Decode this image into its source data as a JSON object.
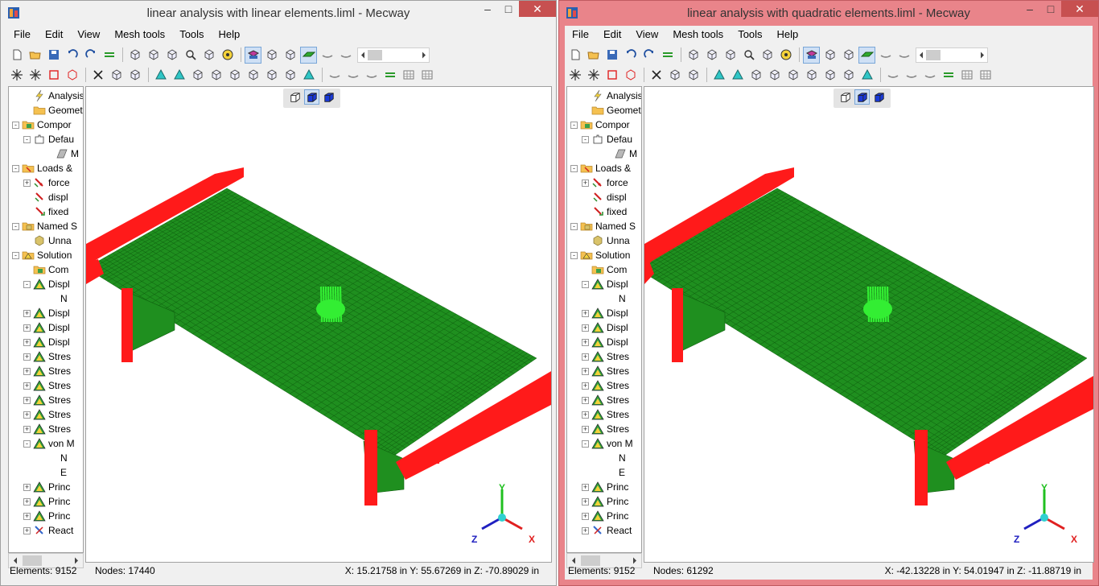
{
  "windows": [
    {
      "title": "linear analysis with linear elements.liml - Mecway",
      "menu": [
        "File",
        "Edit",
        "View",
        "Mesh tools",
        "Tools",
        "Help"
      ],
      "tree": [
        {
          "label": "Analysis",
          "icon": "lightning-icon",
          "indent": 1,
          "expander": ""
        },
        {
          "label": "Geometr",
          "icon": "folder-icon",
          "indent": 1,
          "expander": ""
        },
        {
          "label": "Compor",
          "icon": "component-icon",
          "indent": 0,
          "expander": "-"
        },
        {
          "label": "Defau",
          "icon": "puzzle-icon",
          "indent": 1,
          "expander": "-"
        },
        {
          "label": "M",
          "icon": "material-icon",
          "indent": 3,
          "expander": ""
        },
        {
          "label": "Loads &",
          "icon": "loads-folder-icon",
          "indent": 0,
          "expander": "-"
        },
        {
          "label": "force",
          "icon": "force-arrow-icon",
          "indent": 1,
          "expander": "+"
        },
        {
          "label": "displ",
          "icon": "displacement-icon",
          "indent": 1,
          "expander": ""
        },
        {
          "label": "fixed",
          "icon": "fixed-support-icon",
          "indent": 1,
          "expander": ""
        },
        {
          "label": "Named S",
          "icon": "named-selection-icon",
          "indent": 0,
          "expander": "-"
        },
        {
          "label": "Unna",
          "icon": "cube-icon",
          "indent": 1,
          "expander": ""
        },
        {
          "label": "Solution",
          "icon": "solution-icon",
          "indent": 0,
          "expander": "-"
        },
        {
          "label": "Com",
          "icon": "component-icon",
          "indent": 1,
          "expander": ""
        },
        {
          "label": "Displ",
          "icon": "result-triangle-icon",
          "indent": 1,
          "expander": "-"
        },
        {
          "label": "N",
          "icon": "",
          "indent": 3,
          "expander": ""
        },
        {
          "label": "Displ",
          "icon": "result-triangle-icon",
          "indent": 1,
          "expander": "+"
        },
        {
          "label": "Displ",
          "icon": "result-triangle-icon",
          "indent": 1,
          "expander": "+"
        },
        {
          "label": "Displ",
          "icon": "result-triangle-icon",
          "indent": 1,
          "expander": "+"
        },
        {
          "label": "Stres",
          "icon": "result-triangle-icon",
          "indent": 1,
          "expander": "+"
        },
        {
          "label": "Stres",
          "icon": "result-triangle-icon",
          "indent": 1,
          "expander": "+"
        },
        {
          "label": "Stres",
          "icon": "result-triangle-icon",
          "indent": 1,
          "expander": "+"
        },
        {
          "label": "Stres",
          "icon": "result-triangle-icon",
          "indent": 1,
          "expander": "+"
        },
        {
          "label": "Stres",
          "icon": "result-triangle-icon",
          "indent": 1,
          "expander": "+"
        },
        {
          "label": "Stres",
          "icon": "result-triangle-icon",
          "indent": 1,
          "expander": "+"
        },
        {
          "label": "von M",
          "icon": "result-triangle-icon",
          "indent": 1,
          "expander": "-"
        },
        {
          "label": "N",
          "icon": "",
          "indent": 3,
          "expander": ""
        },
        {
          "label": "E",
          "icon": "",
          "indent": 3,
          "expander": ""
        },
        {
          "label": "Princ",
          "icon": "result-triangle-icon",
          "indent": 1,
          "expander": "+"
        },
        {
          "label": "Princ",
          "icon": "result-triangle-icon",
          "indent": 1,
          "expander": "+"
        },
        {
          "label": "Princ",
          "icon": "result-triangle-icon",
          "indent": 1,
          "expander": "+"
        },
        {
          "label": "React",
          "icon": "reaction-icon",
          "indent": 1,
          "expander": "+"
        }
      ],
      "status": {
        "elements": "Elements:  9152",
        "nodes": "Nodes:  17440",
        "coords": "X: 15.21758 in Y: 55.67269 in Z: -70.89029 in"
      },
      "axis": {
        "x": "X",
        "y": "Y",
        "z": "Z"
      }
    },
    {
      "title": "linear analysis with quadratic elements.liml - Mecway",
      "menu": [
        "File",
        "Edit",
        "View",
        "Mesh tools",
        "Tools",
        "Help"
      ],
      "tree": [
        {
          "label": "Analysis",
          "icon": "lightning-icon",
          "indent": 1,
          "expander": ""
        },
        {
          "label": "Geometr",
          "icon": "folder-icon",
          "indent": 1,
          "expander": ""
        },
        {
          "label": "Compor",
          "icon": "component-icon",
          "indent": 0,
          "expander": "-"
        },
        {
          "label": "Defau",
          "icon": "puzzle-icon",
          "indent": 1,
          "expander": "-"
        },
        {
          "label": "M",
          "icon": "material-icon",
          "indent": 3,
          "expander": ""
        },
        {
          "label": "Loads &",
          "icon": "loads-folder-icon",
          "indent": 0,
          "expander": "-"
        },
        {
          "label": "force",
          "icon": "force-arrow-icon",
          "indent": 1,
          "expander": "+"
        },
        {
          "label": "displ",
          "icon": "displacement-icon",
          "indent": 1,
          "expander": ""
        },
        {
          "label": "fixed",
          "icon": "fixed-support-icon",
          "indent": 1,
          "expander": ""
        },
        {
          "label": "Named S",
          "icon": "named-selection-icon",
          "indent": 0,
          "expander": "-"
        },
        {
          "label": "Unna",
          "icon": "cube-icon",
          "indent": 1,
          "expander": ""
        },
        {
          "label": "Solution",
          "icon": "solution-icon",
          "indent": 0,
          "expander": "-"
        },
        {
          "label": "Com",
          "icon": "component-icon",
          "indent": 1,
          "expander": ""
        },
        {
          "label": "Displ",
          "icon": "result-triangle-icon",
          "indent": 1,
          "expander": "-"
        },
        {
          "label": "N",
          "icon": "",
          "indent": 3,
          "expander": ""
        },
        {
          "label": "Displ",
          "icon": "result-triangle-icon",
          "indent": 1,
          "expander": "+"
        },
        {
          "label": "Displ",
          "icon": "result-triangle-icon",
          "indent": 1,
          "expander": "+"
        },
        {
          "label": "Displ",
          "icon": "result-triangle-icon",
          "indent": 1,
          "expander": "+"
        },
        {
          "label": "Stres",
          "icon": "result-triangle-icon",
          "indent": 1,
          "expander": "+"
        },
        {
          "label": "Stres",
          "icon": "result-triangle-icon",
          "indent": 1,
          "expander": "+"
        },
        {
          "label": "Stres",
          "icon": "result-triangle-icon",
          "indent": 1,
          "expander": "+"
        },
        {
          "label": "Stres",
          "icon": "result-triangle-icon",
          "indent": 1,
          "expander": "+"
        },
        {
          "label": "Stres",
          "icon": "result-triangle-icon",
          "indent": 1,
          "expander": "+"
        },
        {
          "label": "Stres",
          "icon": "result-triangle-icon",
          "indent": 1,
          "expander": "+"
        },
        {
          "label": "von M",
          "icon": "result-triangle-icon",
          "indent": 1,
          "expander": "-"
        },
        {
          "label": "N",
          "icon": "",
          "indent": 3,
          "expander": ""
        },
        {
          "label": "E",
          "icon": "",
          "indent": 3,
          "expander": ""
        },
        {
          "label": "Princ",
          "icon": "result-triangle-icon",
          "indent": 1,
          "expander": "+"
        },
        {
          "label": "Princ",
          "icon": "result-triangle-icon",
          "indent": 1,
          "expander": "+"
        },
        {
          "label": "Princ",
          "icon": "result-triangle-icon",
          "indent": 1,
          "expander": "+"
        },
        {
          "label": "React",
          "icon": "reaction-icon",
          "indent": 1,
          "expander": "+"
        }
      ],
      "status": {
        "elements": "Elements:  9152",
        "nodes": "Nodes:  61292",
        "coords": "X: -42.13228 in Y: 54.01947 in Z: -11.88719 in"
      },
      "axis": {
        "x": "X",
        "y": "Y",
        "z": "Z"
      }
    }
  ],
  "colors": {
    "mesh": "#1f8f1f",
    "mesh_line": "#0e5e0e",
    "constraint": "#ff1a1a",
    "force": "#33ee33",
    "active_frame": "#e9848a",
    "axis_x": "#e02020",
    "axis_y": "#20c020",
    "axis_z": "#2020c0"
  }
}
